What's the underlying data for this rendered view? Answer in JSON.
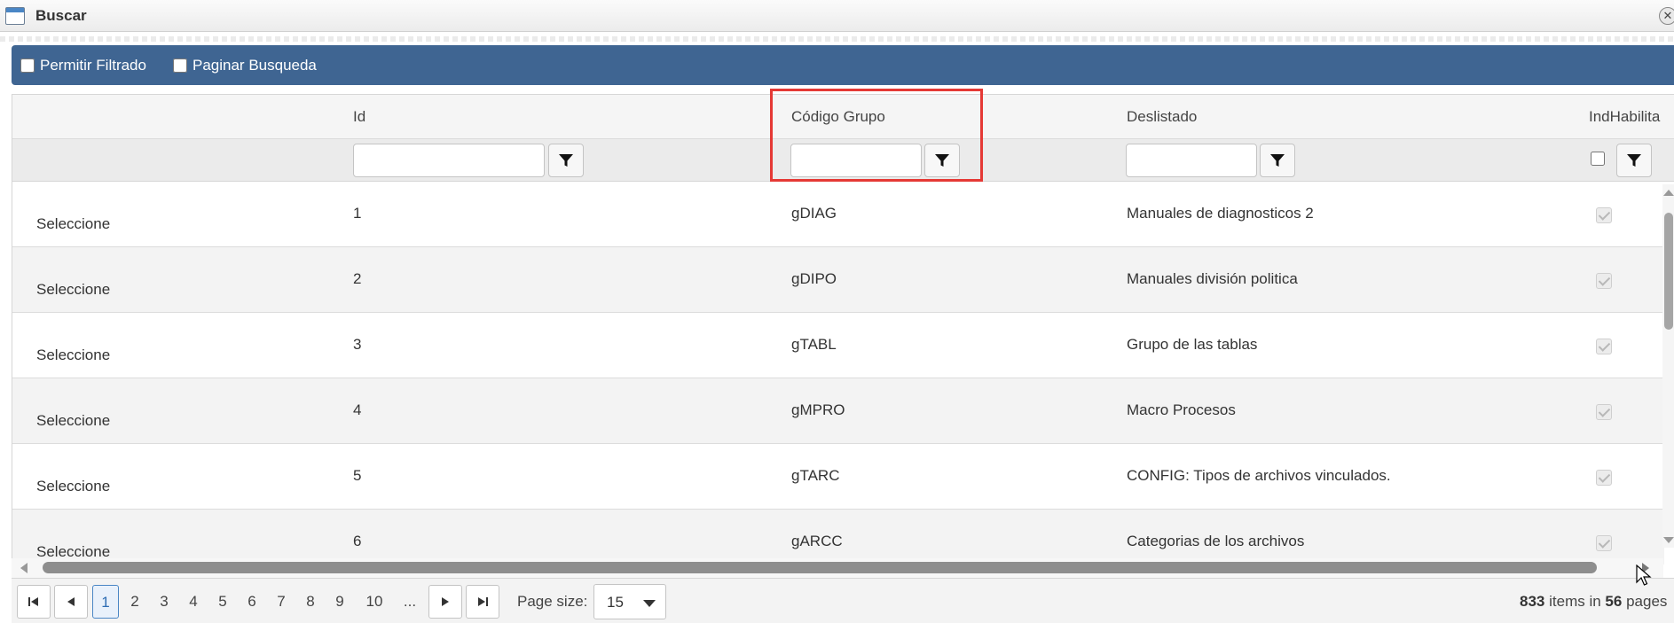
{
  "window": {
    "title": "Buscar"
  },
  "toolbar": {
    "permitir_filtrado_label": "Permitir Filtrado",
    "paginar_busqueda_label": "Paginar Busqueda"
  },
  "grid": {
    "columns": [
      "Id",
      "Código Grupo",
      "Deslistado",
      "IndHabilita"
    ],
    "rows": [
      {
        "select": "Seleccione",
        "id": "1",
        "codigo": "gDIAG",
        "desc": "Manuales de diagnosticos 2"
      },
      {
        "select": "Seleccione",
        "id": "2",
        "codigo": "gDIPO",
        "desc": "Manuales división politica"
      },
      {
        "select": "Seleccione",
        "id": "3",
        "codigo": "gTABL",
        "desc": "Grupo de las tablas"
      },
      {
        "select": "Seleccione",
        "id": "4",
        "codigo": "gMPRO",
        "desc": "Macro Procesos"
      },
      {
        "select": "Seleccione",
        "id": "5",
        "codigo": "gTARC",
        "desc": "CONFIG: Tipos de archivos vinculados."
      },
      {
        "select": "Seleccione",
        "id": "6",
        "codigo": "gARCC",
        "desc": "Categorias de los archivos"
      }
    ]
  },
  "pager": {
    "pages": [
      "1",
      "2",
      "3",
      "4",
      "5",
      "6",
      "7",
      "8",
      "9",
      "10",
      "..."
    ],
    "current_page": "1",
    "page_size_label": "Page size:",
    "page_size": "15",
    "total_items": "833",
    "items_in_text": "items in",
    "total_pages": "56",
    "pages_text": "pages"
  },
  "icons": {
    "filter": "filter-funnel-icon",
    "first": "first-page-icon",
    "prev": "prev-page-icon",
    "next": "next-page-icon",
    "last": "last-page-icon"
  },
  "colors": {
    "toolbar_bg": "#3f6592",
    "highlight": "#e53935",
    "link_blue": "#2e6db4"
  }
}
